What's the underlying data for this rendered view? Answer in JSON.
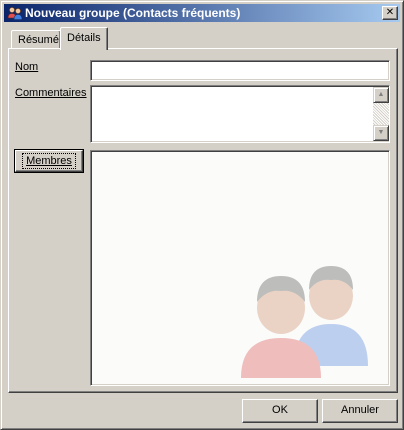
{
  "window": {
    "title": "Nouveau groupe (Contacts fréquents)",
    "close_symbol": "✕",
    "title_icon": "group-contacts-icon"
  },
  "tabs": [
    {
      "label": "Résumé",
      "selected": false
    },
    {
      "label": "Détails",
      "selected": true
    }
  ],
  "form": {
    "nom_label": "Nom",
    "nom_value": "",
    "commentaires_label": "Commentaires",
    "commentaires_value": "",
    "members_button": "Membres",
    "members_list_watermark": "two-people-icon"
  },
  "footer": {
    "ok_label": "OK",
    "cancel_label": "Annuler"
  },
  "colors": {
    "face": "#d4d0c8",
    "title_start": "#0a246a",
    "title_end": "#a6caf0"
  }
}
